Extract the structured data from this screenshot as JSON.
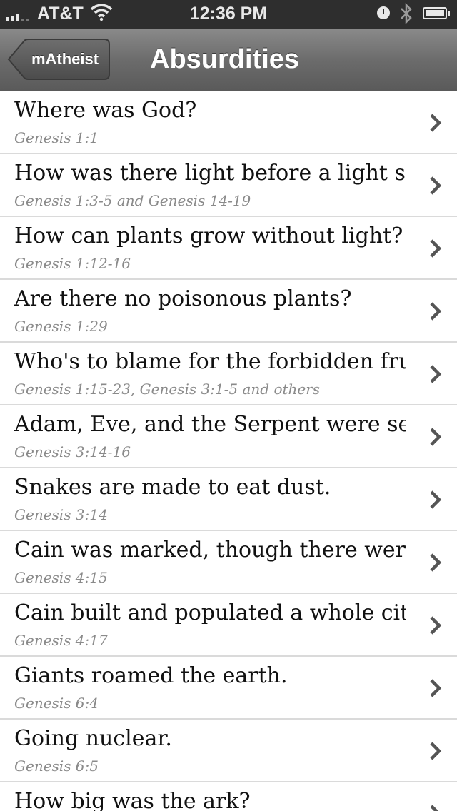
{
  "status_bar": {
    "carrier": "AT&T",
    "time": "12:36 PM",
    "icons": [
      "signal-icon",
      "wifi-icon",
      "clock-icon",
      "bluetooth-icon",
      "battery-icon"
    ]
  },
  "nav_bar": {
    "back_label": "mAtheist",
    "title": "Absurdities"
  },
  "colors": {
    "nav_bar": "#6c6c6c",
    "status_bar": "#2e2e2e",
    "title_text": "#111111",
    "subtitle_text": "#8a8a8a",
    "chevron": "#555555"
  },
  "list": {
    "items": [
      {
        "title": "Where was God?",
        "subtitle": "Genesis 1:1"
      },
      {
        "title": "How was there light before a light so...",
        "subtitle": "Genesis 1:3-5 and Genesis 14-19"
      },
      {
        "title": "How can plants grow without light?",
        "subtitle": "Genesis 1:12-16"
      },
      {
        "title": "Are there no poisonous plants?",
        "subtitle": "Genesis 1:29"
      },
      {
        "title": "Who's to blame for the forbidden fruit?",
        "subtitle": "Genesis 1:15-23, Genesis 3:1-5 and others"
      },
      {
        "title": "Adam, Eve, and the Serpent were set up",
        "subtitle": "Genesis 3:14-16"
      },
      {
        "title": "Snakes are made to eat dust.",
        "subtitle": "Genesis 3:14"
      },
      {
        "title": "Cain was marked, though there were...",
        "subtitle": "Genesis 4:15"
      },
      {
        "title": "Cain built and populated a whole city...",
        "subtitle": "Genesis 4:17"
      },
      {
        "title": "Giants roamed the earth.",
        "subtitle": "Genesis 6:4"
      },
      {
        "title": "Going nuclear.",
        "subtitle": "Genesis 6:5"
      },
      {
        "title": "How big was the ark?",
        "subtitle": ""
      }
    ]
  }
}
